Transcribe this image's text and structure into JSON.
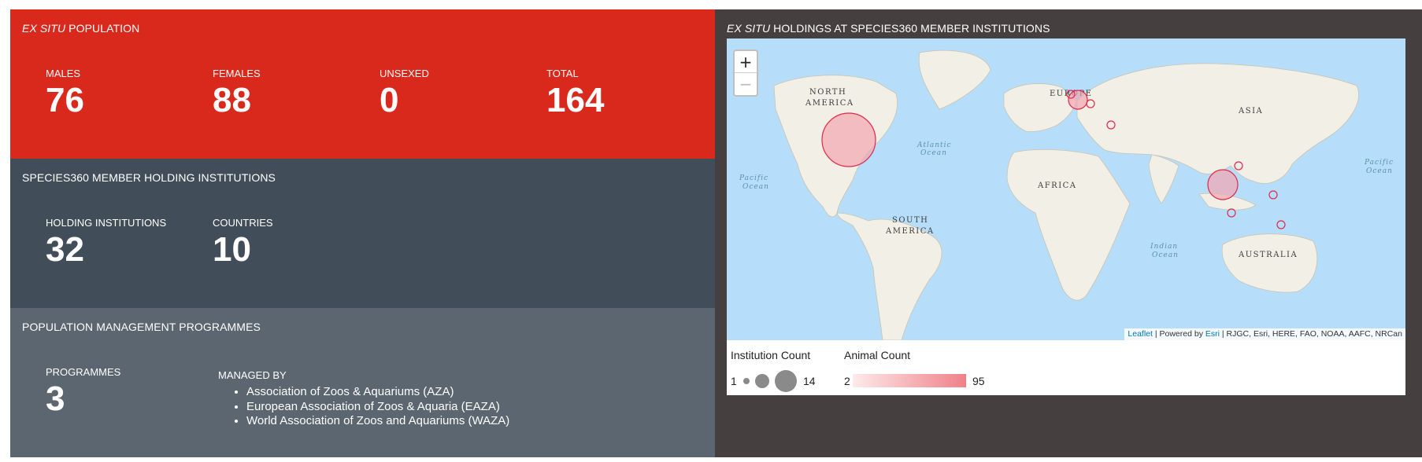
{
  "population": {
    "title_italic": "EX SITU",
    "title_rest": " POPULATION",
    "stats": [
      {
        "label": "MALES",
        "value": "76"
      },
      {
        "label": "FEMALES",
        "value": "88"
      },
      {
        "label": "UNSEXED",
        "value": "0"
      },
      {
        "label": "TOTAL",
        "value": "164"
      }
    ]
  },
  "institutions": {
    "title": "SPECIES360 MEMBER HOLDING INSTITUTIONS",
    "stats": [
      {
        "label": "HOLDING INSTITUTIONS",
        "value": "32"
      },
      {
        "label": "COUNTRIES",
        "value": "10"
      }
    ]
  },
  "programmes": {
    "title": "POPULATION MANAGEMENT PROGRAMMES",
    "stat": {
      "label": "PROGRAMMES",
      "value": "3"
    },
    "managed_label": "MANAGED BY",
    "managed_by": [
      "Association of Zoos & Aquariums (AZA)",
      "European Association of Zoos & Aquaria (EAZA)",
      "World Association of Zoos and Aquariums (WAZA)"
    ]
  },
  "map": {
    "title_italic": "EX SITU",
    "title_rest": " HOLDINGS AT SPECIES360 MEMBER INSTITUTIONS",
    "zoom_in": "+",
    "zoom_out": "−",
    "labels": {
      "north_america_1": "NORTH",
      "north_america_2": "AMERICA",
      "europe": "EUROPE",
      "asia": "ASIA",
      "africa": "AFRICA",
      "south_america_1": "SOUTH",
      "south_america_2": "AMERICA",
      "australia": "AUSTRALIA",
      "atlantic_1": "Atlantic",
      "atlantic_2": "Ocean",
      "pacific_w_1": "Pacific",
      "pacific_w_2": "Ocean",
      "pacific_e_1": "Pacific",
      "pacific_e_2": "Ocean",
      "indian_1": "Indian",
      "indian_2": "Ocean"
    },
    "attribution": {
      "leaflet": "Leaflet",
      "sep1": " | Powered by ",
      "esri": "Esri",
      "rest": " | RJGC, Esri, HERE, FAO, NOAA, AAFC, NRCan"
    },
    "colors": {
      "ocean": "#b6defa",
      "land": "#f2efe6",
      "marker_fill": "#f4a6b0",
      "marker_stroke": "#e0284a"
    }
  },
  "legend": {
    "institution_title": "Institution Count",
    "institution_min": "1",
    "institution_max": "14",
    "animal_title": "Animal Count",
    "animal_min": "2",
    "animal_max": "95"
  }
}
